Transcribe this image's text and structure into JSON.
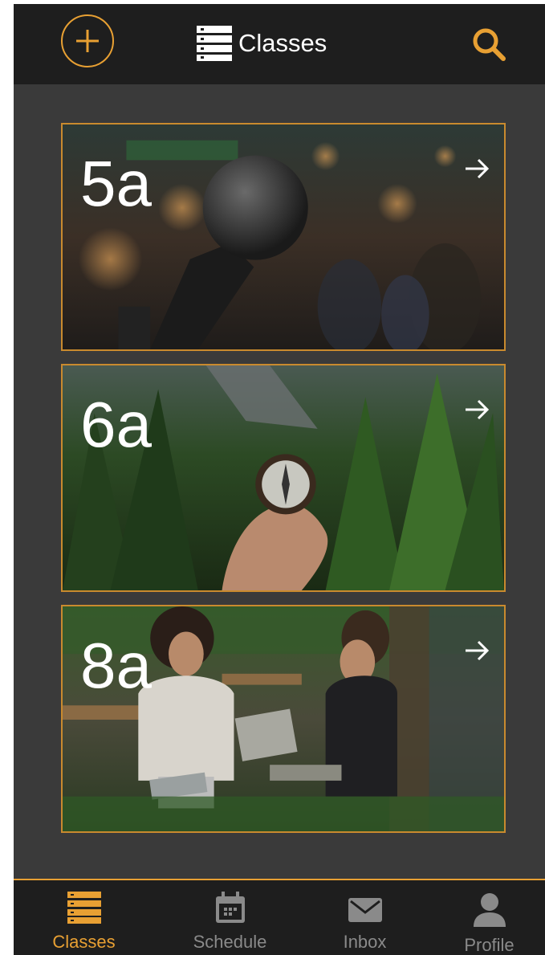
{
  "header": {
    "title": "Classes",
    "add_icon": "plus-circle-icon",
    "title_icon": "server-stack-icon",
    "search_icon": "search-icon"
  },
  "classes": [
    {
      "label": "5a",
      "image": "microphone-photo"
    },
    {
      "label": "6a",
      "image": "compass-forest-photo"
    },
    {
      "label": "8a",
      "image": "people-meeting-photo"
    }
  ],
  "nav": {
    "items": [
      {
        "label": "Classes",
        "icon": "server-stack-icon",
        "active": true
      },
      {
        "label": "Schedule",
        "icon": "calendar-icon",
        "active": false
      },
      {
        "label": "Inbox",
        "icon": "envelope-icon",
        "active": false
      },
      {
        "label": "Profile",
        "icon": "user-icon",
        "active": false
      }
    ]
  },
  "colors": {
    "accent": "#e8a033",
    "header_bg": "#1e1e1e",
    "content_bg": "#3a3a3a",
    "inactive_nav": "#8a8a8a"
  }
}
